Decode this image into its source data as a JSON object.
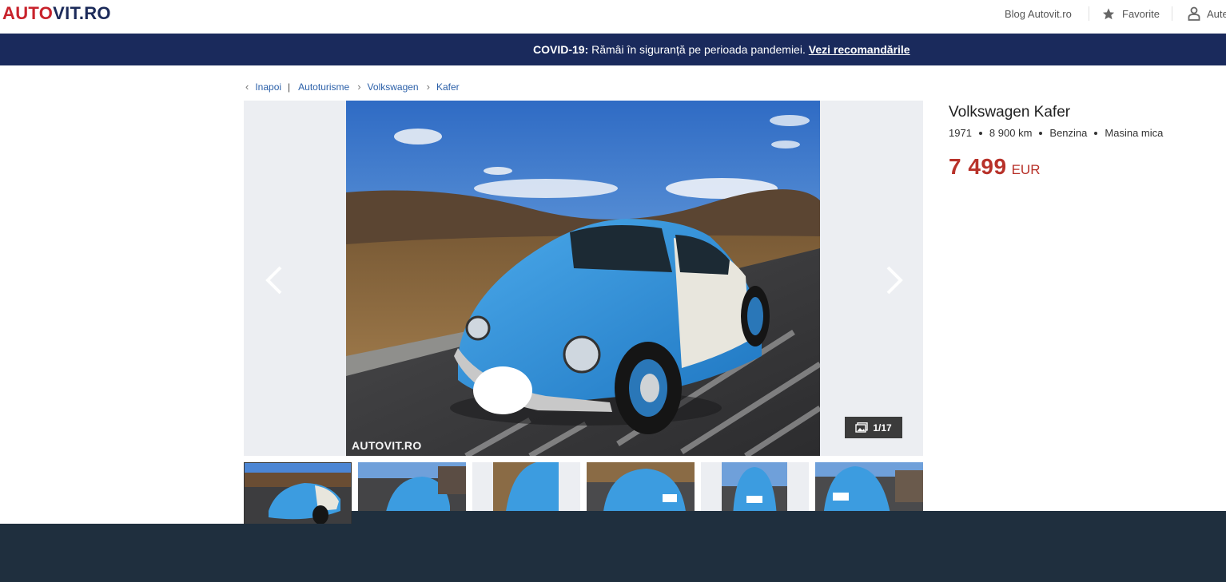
{
  "header": {
    "logo_part1": "AUTO",
    "logo_part2": "VIT.RO",
    "blog_label": "Blog Autovit.ro",
    "favorite_label": "Favorite",
    "account_label": "Aute",
    "favorite_icon": "star-icon",
    "account_icon": "user-icon"
  },
  "banner": {
    "prefix": "COVID-19:",
    "message": " Rămâi în siguranță pe perioada pandemiei. ",
    "link": "Vezi recomandările"
  },
  "breadcrumb": {
    "back": "Inapoi",
    "items": [
      "Autoturisme",
      "Volkswagen",
      "Kafer"
    ]
  },
  "gallery": {
    "counter": "1/17",
    "watermark": "AUTOVIT.RO",
    "thumbnail_count": 6
  },
  "listing": {
    "title": "Volkswagen Kafer",
    "specs": [
      "1971",
      "8 900 km",
      "Benzina",
      "Masina mica"
    ],
    "price": "7 499",
    "currency": "EUR"
  },
  "colors": {
    "brand_red": "#c8232c",
    "brand_navy": "#1c2b5a",
    "banner_bg": "#1a2a5c",
    "price": "#b8322a",
    "link": "#2a5fa8",
    "footer": "#1f2f3e"
  }
}
